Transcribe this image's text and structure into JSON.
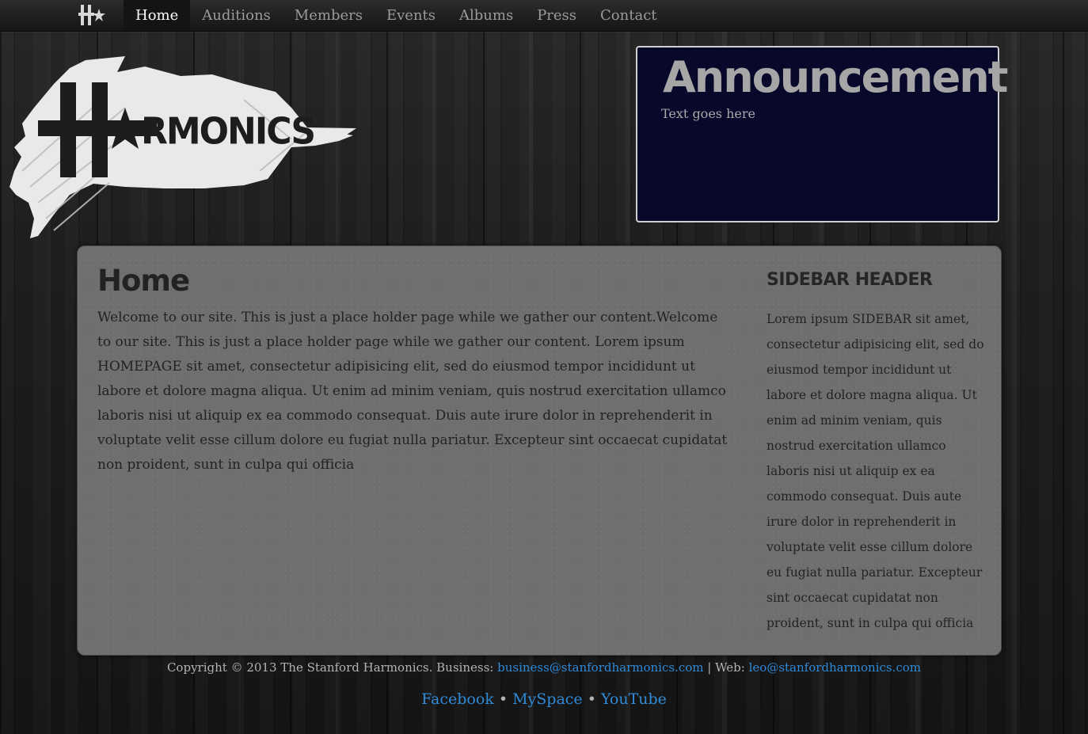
{
  "nav": {
    "items": [
      {
        "label": "Home",
        "active": true
      },
      {
        "label": "Auditions",
        "active": false
      },
      {
        "label": "Members",
        "active": false
      },
      {
        "label": "Events",
        "active": false
      },
      {
        "label": "Albums",
        "active": false
      },
      {
        "label": "Press",
        "active": false
      },
      {
        "label": "Contact",
        "active": false
      }
    ],
    "brand_icon": "harmonics-h-star-icon"
  },
  "header": {
    "logo_text": "HARMONICS",
    "logo_icon": "harmonics-logo"
  },
  "announcement": {
    "title": "Announcement",
    "text": "Text goes here"
  },
  "main": {
    "title": "Home",
    "body": "Welcome to our site. This is just a place holder page while we gather our content.Welcome to our site. This is just a place holder page while we gather our content. Lorem ipsum HOMEPAGE sit amet, consectetur adipisicing elit, sed do eiusmod tempor incididunt ut labore et dolore magna aliqua. Ut enim ad minim veniam, quis nostrud exercitation ullamco laboris nisi ut aliquip ex ea commodo consequat. Duis aute irure dolor in reprehenderit in voluptate velit esse cillum dolore eu fugiat nulla pariatur. Excepteur sint occaecat cupidatat non proident, sunt in culpa qui officia"
  },
  "sidebar": {
    "header": "SIDEBAR HEADER",
    "body": "Lorem ipsum SIDEBAR sit amet, consectetur adipisicing elit, sed do eiusmod tempor incididunt ut labore et dolore magna aliqua. Ut enim ad minim veniam, quis nostrud exercitation ullamco laboris nisi ut aliquip ex ea commodo consequat. Duis aute irure dolor in reprehenderit in voluptate velit esse cillum dolore eu fugiat nulla pariatur. Excepteur sint occaecat cupidatat non proident, sunt in culpa qui officia"
  },
  "footer": {
    "copyright": "Copyright © 2013 The Stanford Harmonics. Business:",
    "business_email": "business@stanfordharmonics.com",
    "web_label": "| Web:",
    "web_email": "leo@stanfordharmonics.com",
    "social": [
      {
        "label": "Facebook"
      },
      {
        "label": "MySpace"
      },
      {
        "label": "YouTube"
      }
    ],
    "separator": "•"
  },
  "colors": {
    "link": "#2f8ad8",
    "announcement_bg": "#08082a",
    "panel_bg": "#6f6f6f"
  }
}
